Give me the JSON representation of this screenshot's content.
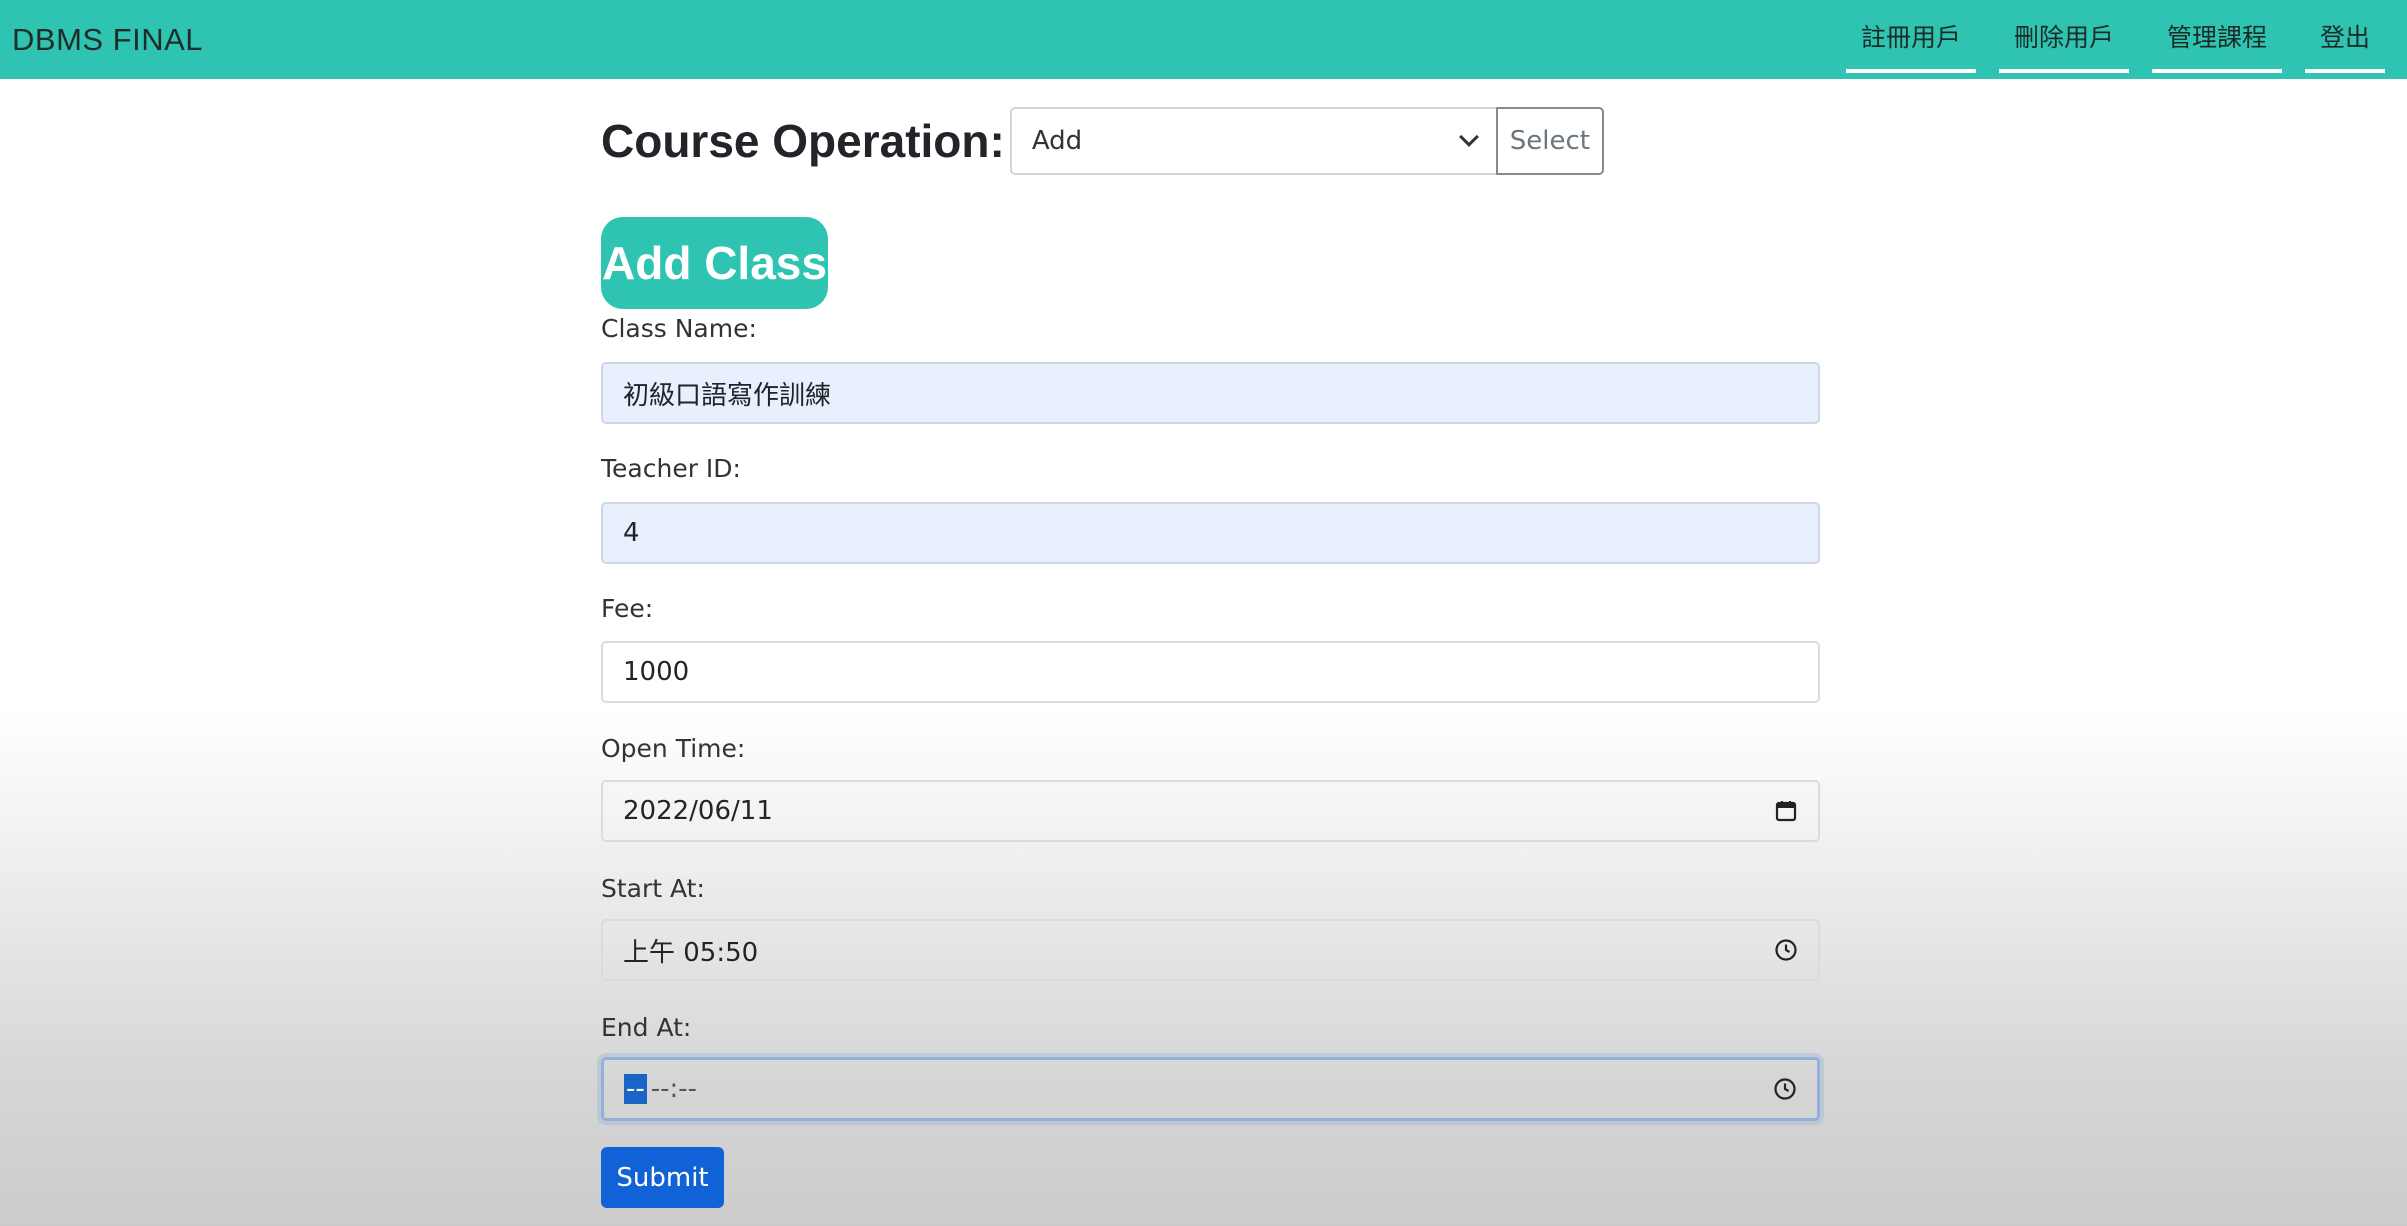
{
  "navbar": {
    "brand": "DBMS FINAL",
    "links": [
      "註冊用戶",
      "刪除用戶",
      "管理課程",
      "登出"
    ]
  },
  "course_operation": {
    "label": "Course Operation:",
    "selected": "Add",
    "button": "Select"
  },
  "form": {
    "heading": "Add Class",
    "class_name": {
      "label": "Class Name:",
      "value": "初級口語寫作訓練"
    },
    "teacher_id": {
      "label": "Teacher ID:",
      "value": "4"
    },
    "fee": {
      "label": "Fee:",
      "value": "1000"
    },
    "open_time": {
      "label": "Open Time:",
      "value": "2022/06/11",
      "icon": "calendar-icon"
    },
    "start_at": {
      "label": "Start At:",
      "value": "上午 05:50",
      "icon": "clock-icon"
    },
    "end_at": {
      "label": "End At:",
      "highlighted_segment": "--",
      "rest": "--:--",
      "icon": "clock-icon"
    },
    "submit": "Submit"
  },
  "colors": {
    "accent": "#2ec4b1",
    "primary": "#1162d6",
    "autofill": "#e8f0fe"
  }
}
